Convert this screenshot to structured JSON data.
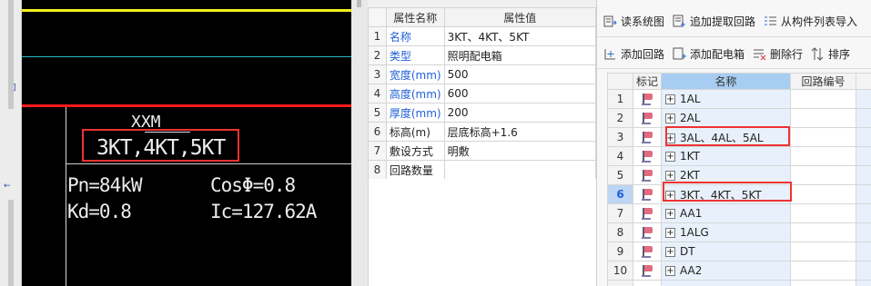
{
  "left_strip": {
    "mark1": "]",
    "mark2": "←"
  },
  "cad": {
    "xxm": "XXM",
    "kt": "3KT,4KT,5KT",
    "pn": "Pn=84kW",
    "cos": "CosΦ=0.8",
    "kd": "Kd=0.8",
    "ic": "Ic=127.62A"
  },
  "props": {
    "col_name": "属性名称",
    "col_value": "属性值",
    "rows": [
      {
        "num": "1",
        "name": "名称",
        "value": "3KT、4KT、5KT"
      },
      {
        "num": "2",
        "name": "类型",
        "value": "照明配电箱"
      },
      {
        "num": "3",
        "name": "宽度(mm)",
        "value": "500"
      },
      {
        "num": "4",
        "name": "高度(mm)",
        "value": "600"
      },
      {
        "num": "5",
        "name": "厚度(mm)",
        "value": "200"
      },
      {
        "num": "6",
        "name": "标高(m)",
        "value": "层底标高+1.6"
      },
      {
        "num": "7",
        "name": "敷设方式",
        "value": "明敷"
      },
      {
        "num": "8",
        "name": "回路数量",
        "value": ""
      }
    ]
  },
  "toolbar1": {
    "read_system": "读系统图",
    "append_extract": "追加提取回路",
    "import_from_list": "从构件列表导入"
  },
  "toolbar2": {
    "add_circuit": "添加回路",
    "add_box": "添加配电箱",
    "delete_row": "删除行",
    "sort": "排序"
  },
  "grid": {
    "col_mark": "标记",
    "col_name": "名称",
    "col_circuit": "回路编号",
    "rows": [
      {
        "num": "1",
        "name": "1AL"
      },
      {
        "num": "2",
        "name": "2AL"
      },
      {
        "num": "3",
        "name": "3AL、4AL、5AL"
      },
      {
        "num": "4",
        "name": "1KT"
      },
      {
        "num": "5",
        "name": "2KT"
      },
      {
        "num": "6",
        "name": "3KT、4KT、5KT"
      },
      {
        "num": "7",
        "name": "AA1"
      },
      {
        "num": "8",
        "name": "1ALG"
      },
      {
        "num": "9",
        "name": "DT"
      },
      {
        "num": "10",
        "name": "AA2"
      }
    ]
  },
  "colors": {
    "accent_red": "#e33333",
    "link_blue": "#1f5fd8",
    "cad_bg": "#000000"
  }
}
